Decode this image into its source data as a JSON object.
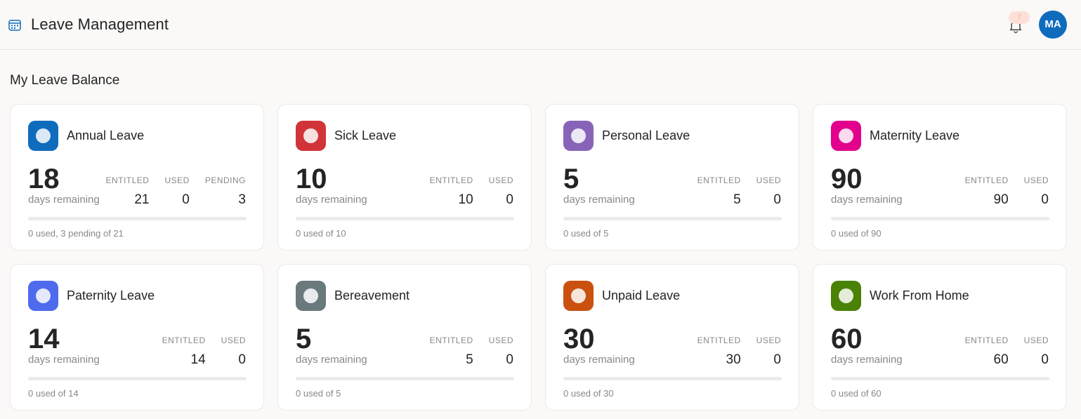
{
  "header": {
    "title": "Leave Management",
    "notification_count": "7",
    "avatar_initials": "MA"
  },
  "section_title": "My Leave Balance",
  "labels": {
    "days_remaining": "days remaining",
    "entitled": "ENTITLED",
    "used": "USED",
    "pending": "PENDING"
  },
  "colors": {
    "accent": "#0f6cbd",
    "annual": "#0f6cbd",
    "sick": "#d13438",
    "personal": "#8764b8",
    "maternity": "#e3008c",
    "paternity": "#4f6bed",
    "bereavement": "#69797e",
    "unpaid": "#ca5010",
    "wfh": "#498205"
  },
  "cards": [
    {
      "title": "Annual Leave",
      "color_key": "annual",
      "remaining": "18",
      "entitled": "21",
      "used": "0",
      "pending": "3",
      "used_fraction": 0,
      "footnote": "0 used, 3 pending of 21"
    },
    {
      "title": "Sick Leave",
      "color_key": "sick",
      "remaining": "10",
      "entitled": "10",
      "used": "0",
      "used_fraction": 0,
      "footnote": "0 used of 10"
    },
    {
      "title": "Personal Leave",
      "color_key": "personal",
      "remaining": "5",
      "entitled": "5",
      "used": "0",
      "used_fraction": 0,
      "footnote": "0 used of 5"
    },
    {
      "title": "Maternity Leave",
      "color_key": "maternity",
      "remaining": "90",
      "entitled": "90",
      "used": "0",
      "used_fraction": 0,
      "footnote": "0 used of 90"
    },
    {
      "title": "Paternity Leave",
      "color_key": "paternity",
      "remaining": "14",
      "entitled": "14",
      "used": "0",
      "used_fraction": 0,
      "footnote": "0 used of 14"
    },
    {
      "title": "Bereavement",
      "color_key": "bereavement",
      "remaining": "5",
      "entitled": "5",
      "used": "0",
      "used_fraction": 0,
      "footnote": "0 used of 5"
    },
    {
      "title": "Unpaid Leave",
      "color_key": "unpaid",
      "remaining": "30",
      "entitled": "30",
      "used": "0",
      "used_fraction": 0,
      "footnote": "0 used of 30"
    },
    {
      "title": "Work From Home",
      "color_key": "wfh",
      "remaining": "60",
      "entitled": "60",
      "used": "0",
      "used_fraction": 0,
      "footnote": "0 used of 60"
    }
  ]
}
